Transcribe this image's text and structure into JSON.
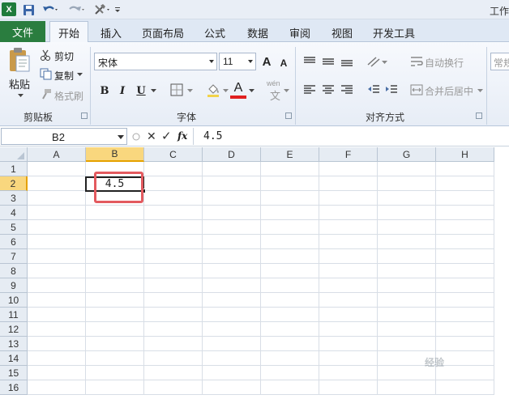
{
  "window": {
    "title": "工作"
  },
  "quick_access": {
    "app_icon": "X"
  },
  "tabs": {
    "file": "文件",
    "items": [
      "开始",
      "插入",
      "页面布局",
      "公式",
      "数据",
      "审阅",
      "视图",
      "开发工具"
    ],
    "active_index": 0
  },
  "ribbon": {
    "clipboard": {
      "paste": "粘贴",
      "cut": "剪切",
      "copy": "复制",
      "format_painter": "格式刷",
      "group_label": "剪贴板"
    },
    "font": {
      "font_name": "宋体",
      "font_size": "11",
      "bold": "B",
      "italic": "I",
      "underline": "U",
      "grow_font": "A",
      "shrink_font": "A",
      "font_color": "A",
      "phonetic": "wén",
      "phonetic_char": "文",
      "group_label": "字体"
    },
    "alignment": {
      "wrap_text": "自动换行",
      "merge_center": "合并后居中",
      "group_label": "对齐方式"
    },
    "number": {
      "format": "常规"
    }
  },
  "formula_bar": {
    "name_box": "B2",
    "fx": "fx",
    "cancel": "✕",
    "enter": "✓",
    "value": "4.5"
  },
  "sheet": {
    "columns": [
      "A",
      "B",
      "C",
      "D",
      "E",
      "F",
      "G",
      "H"
    ],
    "rows": [
      "1",
      "2",
      "3",
      "4",
      "5",
      "6",
      "7",
      "8",
      "9",
      "10",
      "11",
      "12",
      "13",
      "14",
      "15",
      "16"
    ],
    "selected_column": "B",
    "selected_row": "2",
    "active_cell_value": "4.5"
  },
  "watermark": "经验"
}
